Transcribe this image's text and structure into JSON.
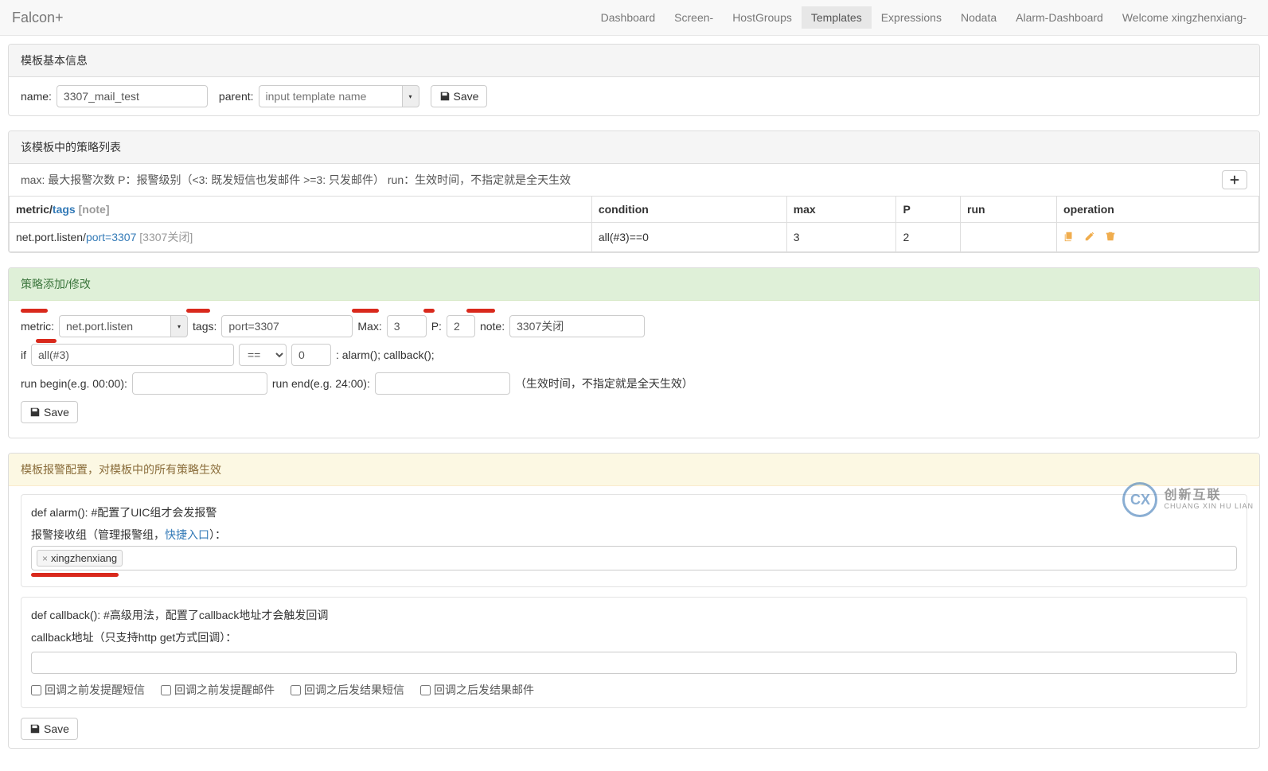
{
  "brand": "Falcon+",
  "nav": {
    "items": [
      "Dashboard",
      "Screen-",
      "HostGroups",
      "Templates",
      "Expressions",
      "Nodata",
      "Alarm-Dashboard",
      "Welcome xingzhenxiang-"
    ],
    "activeIndex": 3
  },
  "panel1": {
    "title": "模板基本信息",
    "name_label": "name:",
    "name_value": "3307_mail_test",
    "parent_label": "parent:",
    "parent_placeholder": "input template name",
    "save": "Save"
  },
  "panel2": {
    "title": "该模板中的策略列表",
    "sub": "max: 最大报警次数 P：报警级别（<3: 既发短信也发邮件 >=3: 只发邮件） run：生效时间，不指定就是全天生效",
    "columns": {
      "metric_tags": "metric/",
      "tags_text": "tags",
      "note_text": " [note]",
      "condition": "condition",
      "max": "max",
      "p": "P",
      "run": "run",
      "operation": "operation"
    },
    "rows": [
      {
        "metric": "net.port.listen/",
        "tags": "port=3307",
        "note": " [3307关闭]",
        "condition": "all(#3)==0",
        "max": "3",
        "p": "2",
        "run": ""
      }
    ]
  },
  "panel3": {
    "title": "策略添加/修改",
    "metric_label": "metric:",
    "metric_value": "net.port.listen",
    "tags_label": "tags:",
    "tags_value": "port=3307",
    "max_label": "Max:",
    "max_value": "3",
    "p_label": "P:",
    "p_value": "2",
    "note_label": "note:",
    "note_value": "3307关闭",
    "if_label": "if",
    "if_value": "all(#3)",
    "op_value": "==",
    "num_value": "0",
    "alarm_text": ": alarm(); callback();",
    "runbegin_label": "run begin(e.g. 00:00):",
    "runend_label": "run end(e.g. 24:00):",
    "runtime_note": "（生效时间，不指定就是全天生效）",
    "save": "Save"
  },
  "panel4": {
    "title": "模板报警配置，对模板中的所有策略生效",
    "alarm_header": "def alarm(): #配置了UIC组才会发报警",
    "recv_label_pre": "报警接收组（管理报警组，",
    "recv_link": "快捷入口",
    "recv_label_post": "）：",
    "recv_tag": "xingzhenxiang",
    "callback_header": "def callback(): #高级用法，配置了callback地址才会触发回调",
    "callback_label": "callback地址（只支持http get方式回调）：",
    "checkboxes": [
      "回调之前发提醒短信",
      "回调之前发提醒邮件",
      "回调之后发结果短信",
      "回调之后发结果邮件"
    ],
    "save": "Save"
  },
  "watermark": {
    "cn": "创新互联",
    "en": "CHUANG XIN HU LIAN"
  }
}
